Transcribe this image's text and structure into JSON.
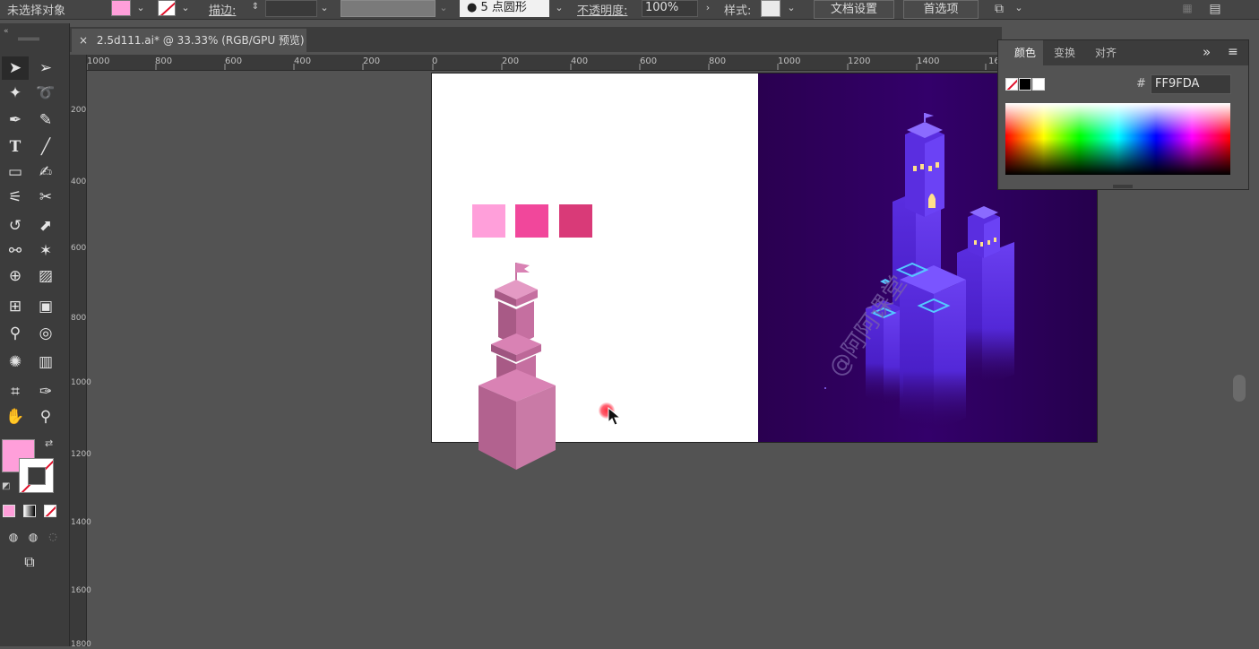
{
  "control_bar": {
    "selection_status": "未选择对象",
    "stroke_label": "描边:",
    "brush_value": "5 点圆形",
    "opacity_label": "不透明度:",
    "opacity_value": "100%",
    "style_label": "样式:",
    "doc_setup_button": "文档设置",
    "preferences_button": "首选项"
  },
  "document_tab": {
    "title": "2.5d111.ai* @ 33.33% (RGB/GPU 预览)",
    "close": "×"
  },
  "ruler": {
    "h_ticks": [
      "1000",
      "800",
      "600",
      "400",
      "200",
      "0",
      "200",
      "400",
      "600",
      "800",
      "1000",
      "1200",
      "1400",
      "16"
    ],
    "v_ticks": [
      "200",
      "400",
      "600",
      "800",
      "1000",
      "1200",
      "1400",
      "1600",
      "1800"
    ]
  },
  "color_panel": {
    "tabs": [
      "颜色",
      "变换",
      "对齐"
    ],
    "hex_symbol": "#",
    "hex_value": "FF9FDA",
    "collapse_glyph": "»"
  },
  "canvas": {
    "swatches": [
      "#ff9fda",
      "#f1479b",
      "#d93a78"
    ],
    "watermark": "@阿阿课堂"
  },
  "colors": {
    "fill": "#ff9fda",
    "artboard_purple": "#2c0055",
    "tower_pink": "#c56fa0"
  }
}
